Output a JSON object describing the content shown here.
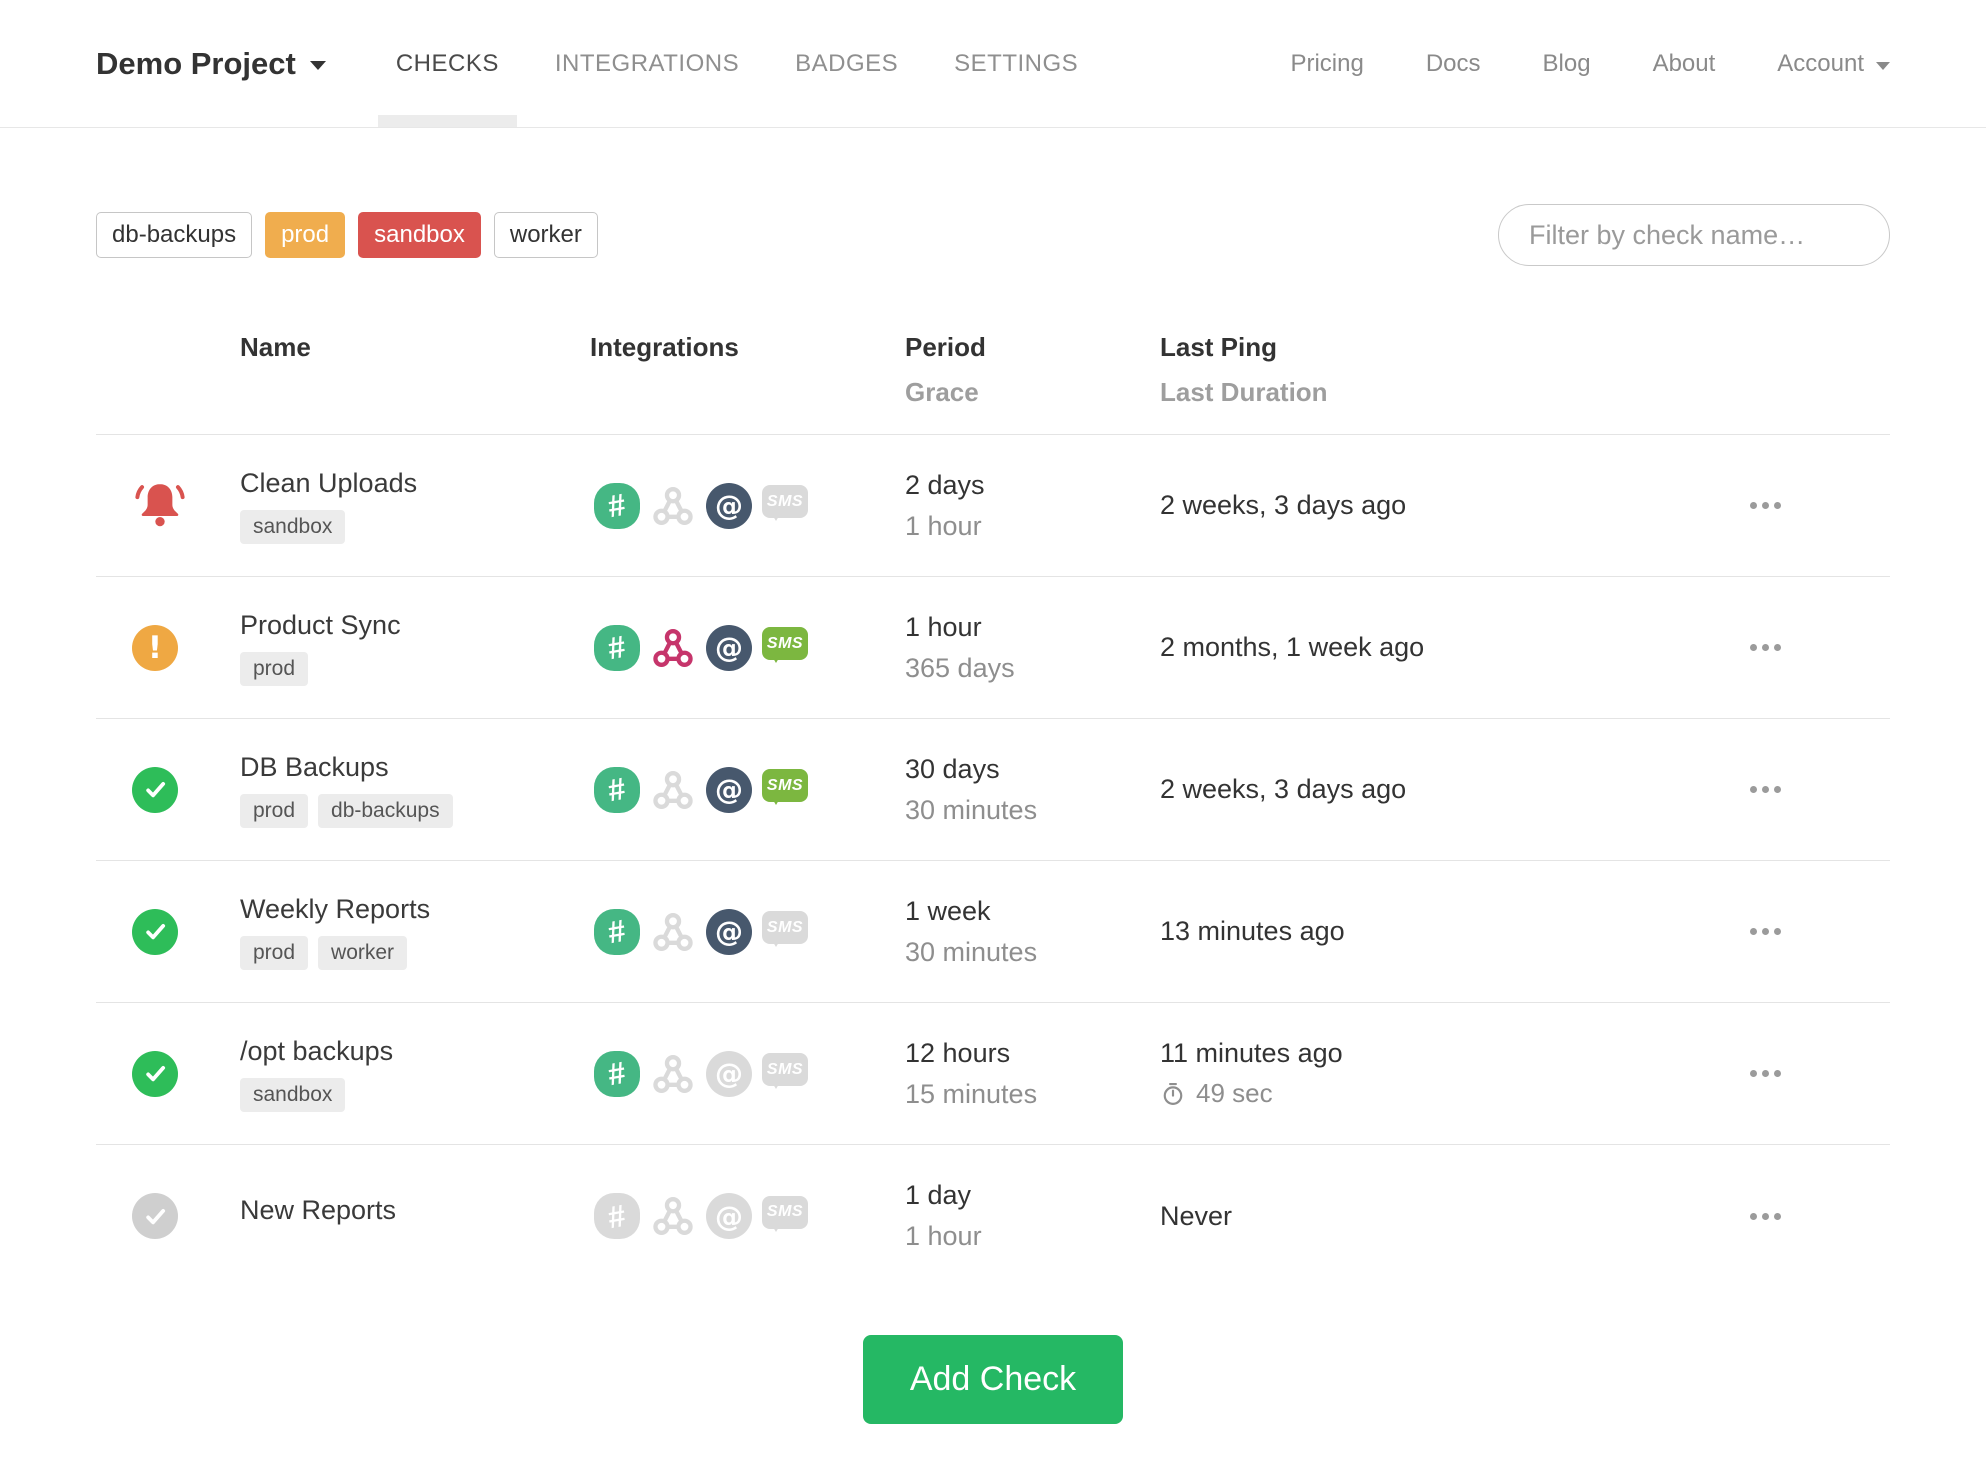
{
  "nav": {
    "project": "Demo Project",
    "tabs": [
      {
        "label": "CHECKS",
        "active": true
      },
      {
        "label": "INTEGRATIONS",
        "active": false
      },
      {
        "label": "BADGES",
        "active": false
      },
      {
        "label": "SETTINGS",
        "active": false
      }
    ],
    "links": [
      "Pricing",
      "Docs",
      "Blog",
      "About"
    ],
    "account": "Account"
  },
  "filters": {
    "tags": [
      {
        "label": "db-backups",
        "style": "outline"
      },
      {
        "label": "prod",
        "style": "orange"
      },
      {
        "label": "sandbox",
        "style": "red"
      },
      {
        "label": "worker",
        "style": "outline"
      }
    ],
    "search_placeholder": "Filter by check name…"
  },
  "table": {
    "headers": {
      "name": "Name",
      "integrations": "Integrations",
      "period": "Period",
      "grace": "Grace",
      "last_ping": "Last Ping",
      "last_duration": "Last Duration"
    },
    "rows": [
      {
        "status": "alert",
        "name": "Clean Uploads",
        "tags": [
          "sandbox"
        ],
        "integrations": {
          "slack": true,
          "webhook": false,
          "email": true,
          "sms": false
        },
        "period": "2 days",
        "grace": "1 hour",
        "last_ping": "2 weeks, 3 days ago",
        "last_duration": ""
      },
      {
        "status": "late",
        "name": "Product Sync",
        "tags": [
          "prod"
        ],
        "integrations": {
          "slack": true,
          "webhook": true,
          "email": true,
          "sms": true
        },
        "period": "1 hour",
        "grace": "365 days",
        "last_ping": "2 months, 1 week ago",
        "last_duration": ""
      },
      {
        "status": "up",
        "name": "DB Backups",
        "tags": [
          "prod",
          "db-backups"
        ],
        "integrations": {
          "slack": true,
          "webhook": false,
          "email": true,
          "sms": true
        },
        "period": "30 days",
        "grace": "30 minutes",
        "last_ping": "2 weeks, 3 days ago",
        "last_duration": ""
      },
      {
        "status": "up",
        "name": "Weekly Reports",
        "tags": [
          "prod",
          "worker"
        ],
        "integrations": {
          "slack": true,
          "webhook": false,
          "email": true,
          "sms": false
        },
        "period": "1 week",
        "grace": "30 minutes",
        "last_ping": "13 minutes ago",
        "last_duration": ""
      },
      {
        "status": "up",
        "name": "/opt backups",
        "tags": [
          "sandbox"
        ],
        "integrations": {
          "slack": true,
          "webhook": false,
          "email": false,
          "sms": false
        },
        "period": "12 hours",
        "grace": "15 minutes",
        "last_ping": "11 minutes ago",
        "last_duration": "49 sec"
      },
      {
        "status": "new",
        "name": "New Reports",
        "tags": [],
        "integrations": {
          "slack": false,
          "webhook": false,
          "email": false,
          "sms": false
        },
        "period": "1 day",
        "grace": "1 hour",
        "last_ping": "Never",
        "last_duration": ""
      }
    ]
  },
  "icons": {
    "statuses": {
      "up": "check-circle-icon",
      "new": "check-circle-gray-icon",
      "late": "exclamation-circle-icon",
      "alert": "alert-bell-icon"
    },
    "integrations": [
      "slack-icon",
      "webhook-icon",
      "email-icon",
      "sms-icon"
    ],
    "misc": [
      "caret-down-icon",
      "stopwatch-icon",
      "row-menu-dots-icon"
    ]
  },
  "colors": {
    "status_up": "#2ebd59",
    "status_new": "#cfcfcf",
    "status_late": "#efa843",
    "status_alert": "#d9534f",
    "slack": "#45b784",
    "webhook": "#c6356b",
    "email": "#47586d",
    "sms": "#7cb740",
    "inactive_icon": "#dadada",
    "tag_orange": "#f0ad4e",
    "tag_red": "#d9534f",
    "add_check": "#25b864"
  },
  "actions": {
    "add_check_label": "Add Check"
  }
}
